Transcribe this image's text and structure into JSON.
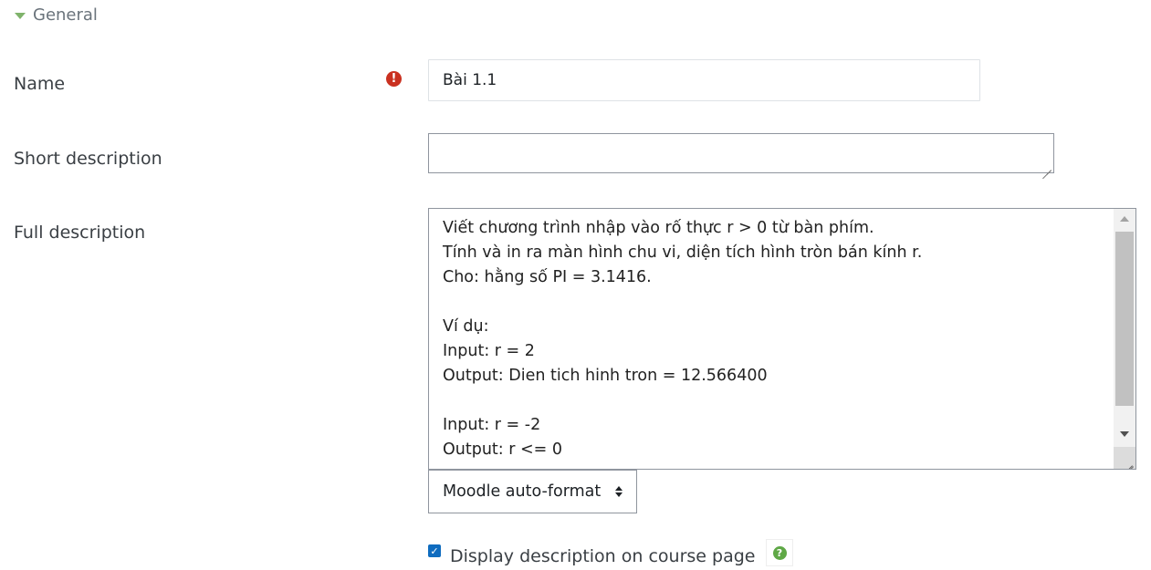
{
  "section": {
    "title": "General",
    "caret_icon": "caret-down-icon"
  },
  "fields": {
    "name": {
      "label": "Name",
      "value": "Bài 1.1",
      "required_icon": "exclamation-circle-icon"
    },
    "short_description": {
      "label": "Short description",
      "value": ""
    },
    "full_description": {
      "label": "Full description",
      "value": "Viết chương trình nhập vào rố thực r > 0 từ bàn phím.\nTính và in ra màn hình chu vi, diện tích hình tròn bán kính r.\nCho: hằng số PI = 3.1416.\n\nVí dụ:\nInput: r = 2\nOutput: Dien tich hinh tron = 12.566400\n\nInput: r = -2\nOutput: r <= 0"
    },
    "format": {
      "selected": "Moodle auto-format"
    },
    "display_on_course": {
      "label": "Display description on course page",
      "checked": true,
      "help_icon": "question-circle-icon"
    }
  },
  "colors": {
    "required": "#ca3120",
    "checkbox": "#0f6cbf",
    "help": "#5fa846",
    "caret": "#7fb36b"
  }
}
